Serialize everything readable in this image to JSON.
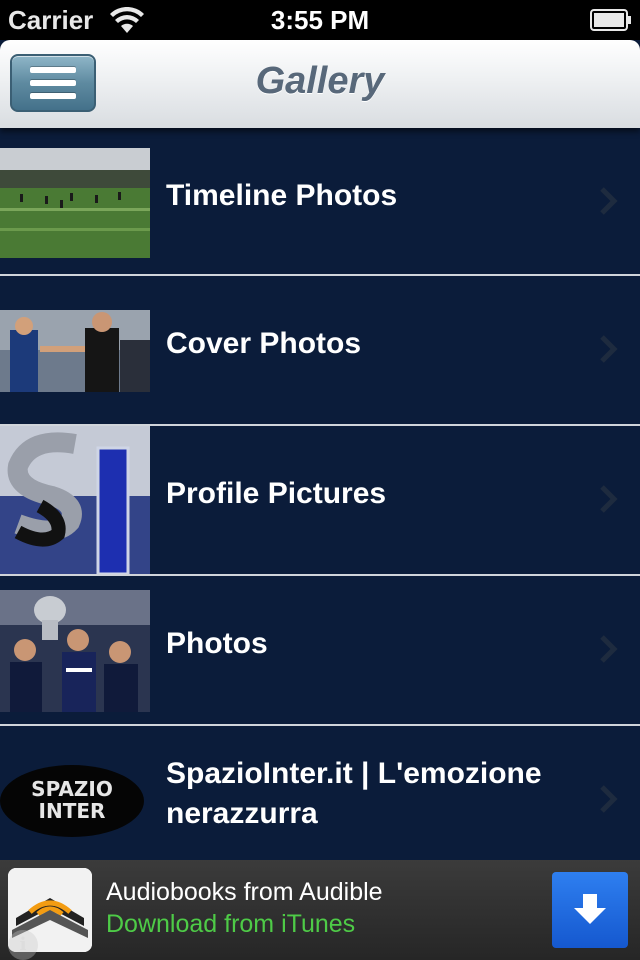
{
  "status_bar": {
    "carrier": "Carrier",
    "time": "3:55 PM",
    "icons": [
      "wifi-icon",
      "battery-icon"
    ]
  },
  "nav": {
    "title": "Gallery",
    "menu_icon": "hamburger-menu-icon"
  },
  "albums": [
    {
      "label": "Timeline Photos",
      "thumbnail": "soccer-field-photo"
    },
    {
      "label": "Cover Photos",
      "thumbnail": "players-handshake-photo"
    },
    {
      "label": "Profile Pictures",
      "thumbnail": "si-logo-photo"
    },
    {
      "label": "Photos",
      "thumbnail": "trophy-celebration-photo"
    },
    {
      "label": "SpazioInter.it | L'emozione nerazzurra",
      "thumbnail": "spazio-inter-logo"
    }
  ],
  "ad": {
    "title": "Audiobooks from Audible",
    "subtitle": "Download from iTunes",
    "icon": "audible-logo-icon",
    "action_icon": "download-arrow-icon",
    "info_icon": "info-icon",
    "colors": {
      "subtitle": "#4ecb47",
      "button": "#1e6be6"
    }
  },
  "colors": {
    "list_background": "#0b1c3a",
    "separator": "#d0d4da",
    "nav_title": "#58687a"
  }
}
